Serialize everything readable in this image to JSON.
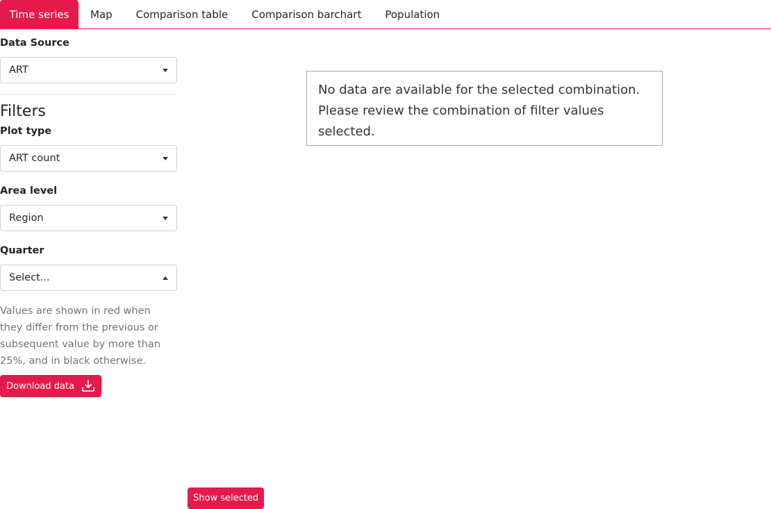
{
  "tabs": [
    {
      "label": "Time series",
      "active": true
    },
    {
      "label": "Map",
      "active": false
    },
    {
      "label": "Comparison table",
      "active": false
    },
    {
      "label": "Comparison barchart",
      "active": false
    },
    {
      "label": "Population",
      "active": false
    }
  ],
  "sidebar": {
    "data_source": {
      "label": "Data Source",
      "value": "ART"
    },
    "filters_heading": "Filters",
    "plot_type": {
      "label": "Plot type",
      "value": "ART count"
    },
    "area_level": {
      "label": "Area level",
      "value": "Region"
    },
    "quarter": {
      "label": "Quarter",
      "value": "Select..."
    },
    "help_text": "Values are shown in red when they differ from the previous or subsequent value by more than 25%, and in black otherwise.",
    "download_label": "Download data"
  },
  "main": {
    "message": "No data are available for the selected combination. Please review the combination of filter values selected.",
    "show_selected_label": "Show selected"
  },
  "colors": {
    "accent": "#e31a4b",
    "border": "#ced4da",
    "muted_text": "#6c757d"
  },
  "icons": {
    "select_caret": "chevron-down-icon",
    "select_caret_open": "chevron-up-icon",
    "download": "download-icon"
  }
}
